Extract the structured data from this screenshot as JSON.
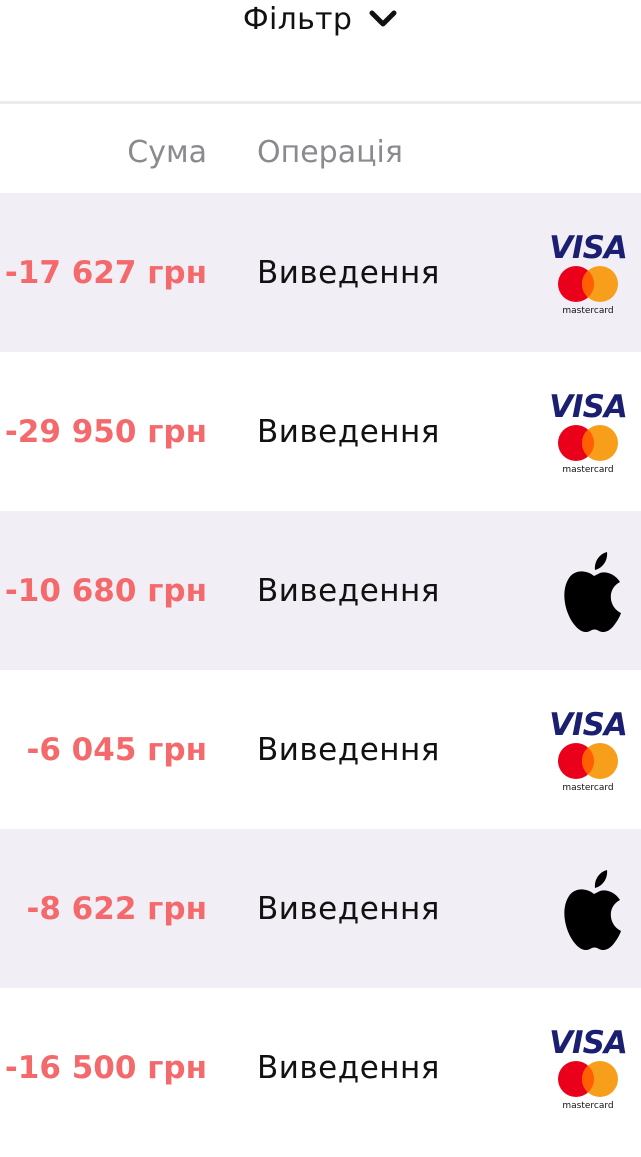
{
  "filter": {
    "label": "Фільтр",
    "icon": "chevron-down-icon"
  },
  "table": {
    "headers": {
      "amount": "Сума",
      "operation": "Операція"
    },
    "rows": [
      {
        "amount": "-17 627 грн",
        "operation": "Виведення",
        "method": "visa-mastercard",
        "visa_text": "VISA",
        "mc_text": "mastercard"
      },
      {
        "amount": "-29 950 грн",
        "operation": "Виведення",
        "method": "visa-mastercard",
        "visa_text": "VISA",
        "mc_text": "mastercard"
      },
      {
        "amount": "-10 680 грн",
        "operation": "Виведення",
        "method": "apple"
      },
      {
        "amount": "-6 045 грн",
        "operation": "Виведення",
        "method": "visa-mastercard",
        "visa_text": "VISA",
        "mc_text": "mastercard"
      },
      {
        "amount": "-8 622 грн",
        "operation": "Виведення",
        "method": "apple"
      },
      {
        "amount": "-16 500 грн",
        "operation": "Виведення",
        "method": "visa-mastercard",
        "visa_text": "VISA",
        "mc_text": "mastercard"
      }
    ]
  },
  "colors": {
    "negative_amount": "#f4696b",
    "row_alt_bg": "#f1eff5",
    "header_text": "#8a8a8f",
    "visa_blue": "#1a1f71",
    "mc_red": "#eb001b",
    "mc_yellow": "#f79e1b",
    "mc_overlap": "#ff5f00"
  }
}
